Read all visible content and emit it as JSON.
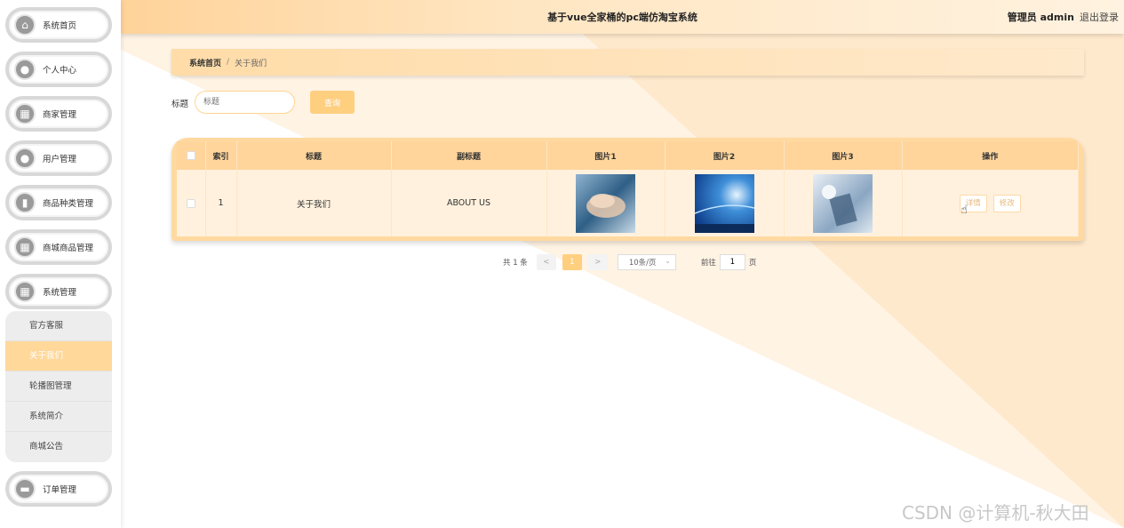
{
  "header": {
    "title": "基于vue全家桶的pc端仿淘宝系统",
    "user": "管理员 admin",
    "logout": "退出登录"
  },
  "sidebar": {
    "items": [
      {
        "label": "系统首页",
        "icon": "home-icon",
        "glyph": "⌂"
      },
      {
        "label": "个人中心",
        "icon": "user-icon",
        "glyph": "●"
      },
      {
        "label": "商家管理",
        "icon": "grid-icon",
        "glyph": "▦"
      },
      {
        "label": "用户管理",
        "icon": "user-icon",
        "glyph": "●"
      },
      {
        "label": "商品种类管理",
        "icon": "chart-icon",
        "glyph": "▮"
      },
      {
        "label": "商城商品管理",
        "icon": "apps-icon",
        "glyph": "▦"
      },
      {
        "label": "系统管理",
        "icon": "apps-icon",
        "glyph": "▦"
      },
      {
        "label": "订单管理",
        "icon": "bag-icon",
        "glyph": "▬"
      }
    ],
    "submenu": [
      "官方客服",
      "关于我们",
      "轮播图管理",
      "系统简介",
      "商城公告"
    ],
    "active_sub": "关于我们"
  },
  "breadcrumb": {
    "home": "系统首页",
    "separator": "/",
    "current": "关于我们"
  },
  "search": {
    "label": "标题",
    "placeholder": "标题",
    "button": "查询"
  },
  "table": {
    "columns": [
      "索引",
      "标题",
      "副标题",
      "图片1",
      "图片2",
      "图片3",
      "操作"
    ],
    "rows": [
      {
        "index": "1",
        "title": "关于我们",
        "subtitle": "ABOUT US",
        "actions": [
          "详情",
          "修改"
        ]
      }
    ]
  },
  "pagination": {
    "total": "共 1 条",
    "prev": "<",
    "page": "1",
    "next": ">",
    "page_size": "10条/页",
    "goto_prefix": "前往",
    "goto_value": "1",
    "goto_suffix": "页"
  },
  "watermark": "CSDN @计算机-秋大田",
  "colors": {
    "accent": "#ffcf80",
    "header_start": "#ffd39a",
    "row_bg": "#fff1de"
  }
}
